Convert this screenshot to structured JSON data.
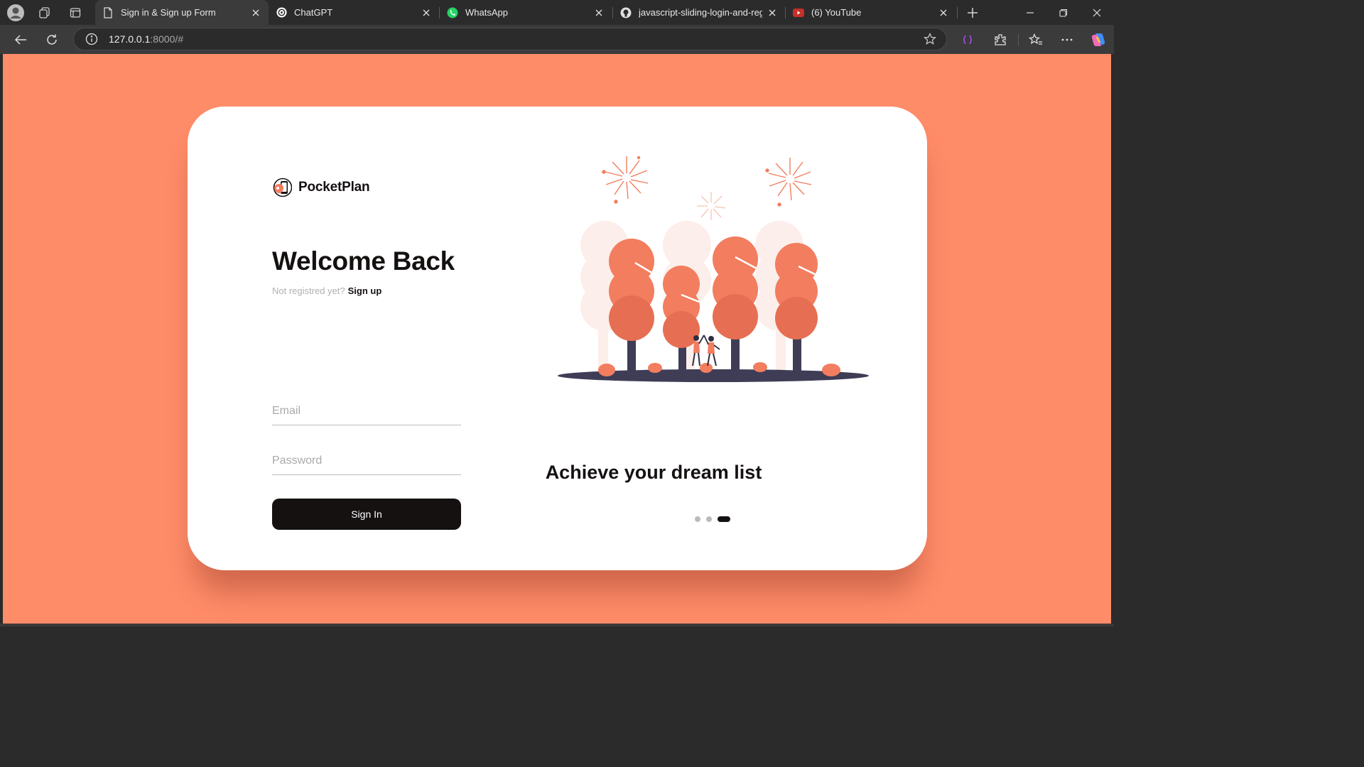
{
  "browser": {
    "tabs": [
      {
        "title": "Sign in & Sign up Form",
        "icon": "page-icon",
        "active": true
      },
      {
        "title": "ChatGPT",
        "icon": "chatgpt-icon",
        "active": false
      },
      {
        "title": "WhatsApp",
        "icon": "whatsapp-icon",
        "active": false
      },
      {
        "title": "javascript-sliding-login-and-regis",
        "icon": "github-icon",
        "active": false
      },
      {
        "title": "(6) YouTube",
        "icon": "youtube-icon",
        "active": false
      }
    ],
    "address": {
      "host": "127.0.0.1",
      "path": ":8000/#"
    }
  },
  "page": {
    "background": "#ff8c69",
    "logo_text": "PocketPlan",
    "heading": "Welcome Back",
    "subline_muted": "Not registred yet?",
    "subline_link": "Sign up",
    "email_placeholder": "Email",
    "password_placeholder": "Password",
    "signin_label": "Sign In",
    "tagline": "Achieve your dream list",
    "carousel": {
      "count": 3,
      "active": 3
    }
  },
  "colors": {
    "accent": "#ff8c69",
    "dark": "#151111",
    "tree": "#f27d5f",
    "ground": "#3f3d56"
  }
}
